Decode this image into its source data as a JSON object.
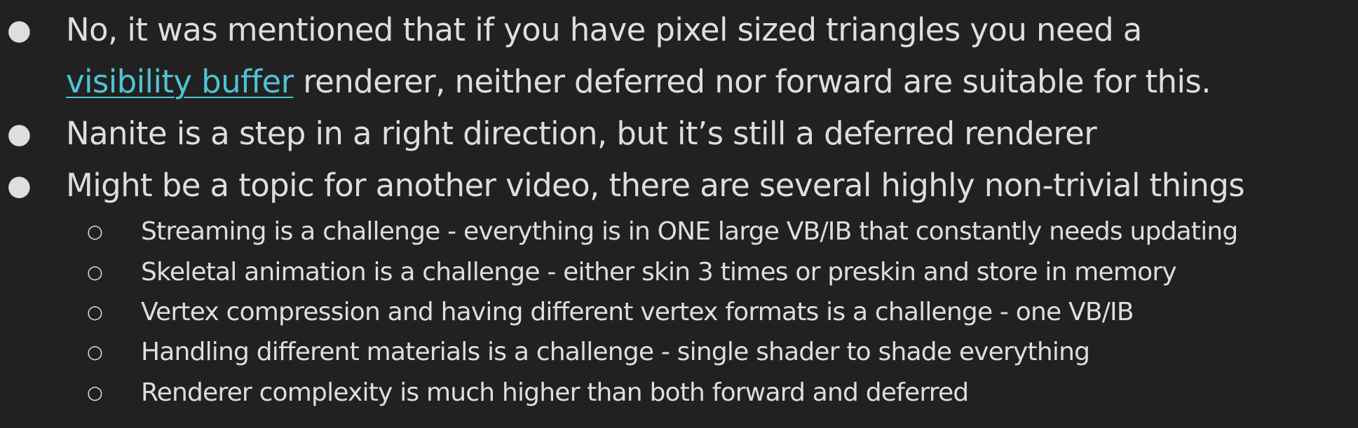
{
  "bullets": [
    {
      "marker": "●",
      "before_link": "No, it was mentioned that if you have pixel sized triangles you need a",
      "link": "visibility buffer",
      "after_link": " renderer, neither deferred nor forward are suitable for this."
    },
    {
      "marker": "●",
      "text": "Nanite is a step in a right direction, but it’s still a deferred renderer"
    },
    {
      "marker": "●",
      "text": "Might be a topic for another video, there are several highly non-trivial things"
    }
  ],
  "sub_bullets": [
    {
      "marker": "○",
      "text": "Streaming is a challenge - everything is in ONE large VB/IB that constantly needs updating"
    },
    {
      "marker": "○",
      "text": "Skeletal animation is a challenge - either skin 3 times or preskin and store in memory"
    },
    {
      "marker": "○",
      "text": "Vertex compression and having different vertex formats is a challenge - one VB/IB"
    },
    {
      "marker": "○",
      "text": "Handling different materials is a challenge - single shader to shade everything"
    },
    {
      "marker": "○",
      "text": "Renderer complexity is much higher than both forward and deferred"
    }
  ],
  "colors": {
    "background": "#212121",
    "text": "#dedede",
    "link": "#4fc3d3"
  }
}
